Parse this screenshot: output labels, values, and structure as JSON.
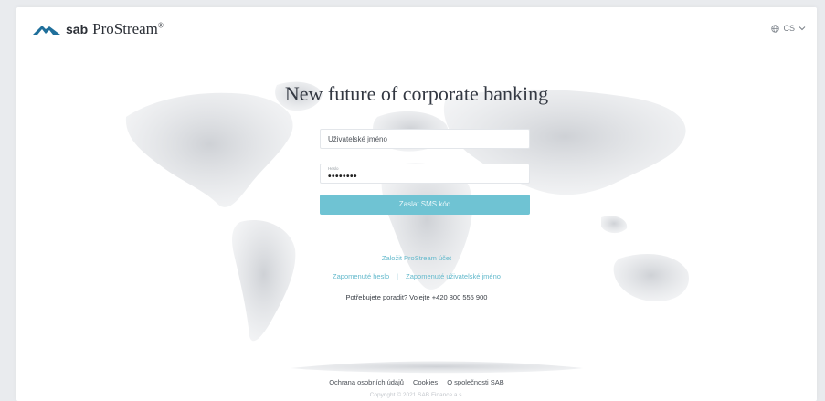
{
  "brand": {
    "short": "sab",
    "product": "ProStream",
    "mark": "®"
  },
  "language": {
    "current": "CS",
    "icon": "globe-icon"
  },
  "headline": "New future of corporate banking",
  "form": {
    "username_placeholder": "Uživatelské jméno",
    "password_label": "Heslo",
    "password_value": "••••••••",
    "submit_label": "Zaslat SMS kód"
  },
  "links": {
    "create_account": "Založit ProStream účet",
    "forgot_password": "Zapomenuté heslo",
    "separator": "|",
    "forgot_username": "Zapomenuté uživatelské jméno"
  },
  "help_text": "Potřebujete poradit? Volejte +420 800 555 900",
  "footer": {
    "privacy": "Ochrana osobních údajů",
    "cookies": "Cookies",
    "about": "O společnosti SAB",
    "copyright": "Copyright © 2021 SAB Finance a.s."
  },
  "colors": {
    "accent": "#6fc3d3",
    "link": "#63b9cc",
    "text": "#333842",
    "logo": "#1f6f9b"
  }
}
